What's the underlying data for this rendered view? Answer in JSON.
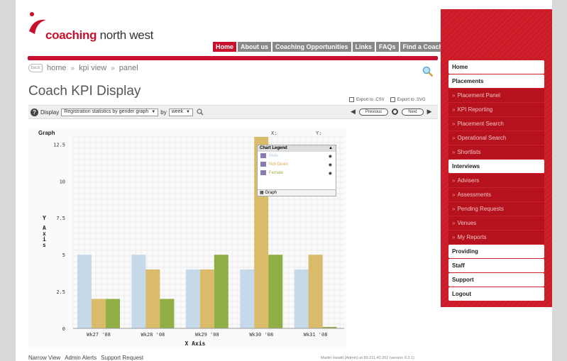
{
  "brand": {
    "name_bold": "coaching",
    "name_rest": " north west",
    "accent": "#c8102e"
  },
  "topnav": [
    {
      "label": "Home",
      "active": true
    },
    {
      "label": "About us",
      "active": false
    },
    {
      "label": "Coaching Opportunities",
      "active": false
    },
    {
      "label": "Links",
      "active": false
    },
    {
      "label": "FAQs",
      "active": false
    },
    {
      "label": "Find a Coach",
      "active": false
    }
  ],
  "breadcrumb": {
    "back": "back",
    "items": [
      "home",
      "kpi view",
      "panel"
    ],
    "separator": "»"
  },
  "page_title": "Coach KPI Display",
  "exports": {
    "csv": "Export to .CSV",
    "svg": "Export to .SVG"
  },
  "toolbar": {
    "display_label": "Display",
    "graph_select": "Registration statistics by gender graph",
    "by_label": "by",
    "period_select": "week",
    "previous": "Previous",
    "next": "Next"
  },
  "chart_data": {
    "type": "bar",
    "title": "Graph",
    "xlabel": "X Axis",
    "ylabel": "Y Axis",
    "ylim": [
      0,
      13
    ],
    "yticks": [
      0,
      2.5,
      5,
      7.5,
      10,
      12.5
    ],
    "ytick_labels": [
      "0",
      "2.5",
      "5",
      "7.5",
      "10",
      "12.5"
    ],
    "categories": [
      "Wk27 '08",
      "Wk28 '08",
      "Wk29 '08",
      "Wk30 '08",
      "Wk31 '08"
    ],
    "series": [
      {
        "name": "Male",
        "color": "#c6d9ea",
        "values": [
          5,
          5,
          4,
          4,
          4
        ]
      },
      {
        "name": "Not-Given",
        "color": "#d9bb6a",
        "values": [
          2,
          4,
          4,
          13,
          5
        ]
      },
      {
        "name": "Female",
        "color": "#8faf45",
        "values": [
          2,
          2,
          5,
          5,
          0.1
        ]
      }
    ],
    "cursor_labels": {
      "x": "X:",
      "y": "Y:"
    },
    "legend": {
      "title": "Chart Legend",
      "footer": "Graph",
      "position": "top-right"
    }
  },
  "footer": {
    "links": [
      "Narrow View",
      "Admin Alerts",
      "Support Request"
    ],
    "status": "Martin Hewitt (Admin) at 89.211.40.202 (version 0.3.1)"
  },
  "side_menu": [
    {
      "label": "Home",
      "type": "main"
    },
    {
      "label": "Placements",
      "type": "main"
    },
    {
      "label": "Placement Panel",
      "type": "sub"
    },
    {
      "label": "KPI Reporting",
      "type": "sub"
    },
    {
      "label": "Placement Search",
      "type": "sub"
    },
    {
      "label": "Operational Search",
      "type": "sub"
    },
    {
      "label": "Shortlists",
      "type": "sub"
    },
    {
      "label": "Interviews",
      "type": "main"
    },
    {
      "label": "Advisers",
      "type": "sub"
    },
    {
      "label": "Assessments",
      "type": "sub"
    },
    {
      "label": "Pending Requests",
      "type": "sub"
    },
    {
      "label": "Venues",
      "type": "sub"
    },
    {
      "label": "My Reports",
      "type": "sub"
    },
    {
      "label": "Providing",
      "type": "main"
    },
    {
      "label": "Staff",
      "type": "main"
    },
    {
      "label": "Support",
      "type": "main"
    },
    {
      "label": "Logout",
      "type": "main"
    }
  ]
}
